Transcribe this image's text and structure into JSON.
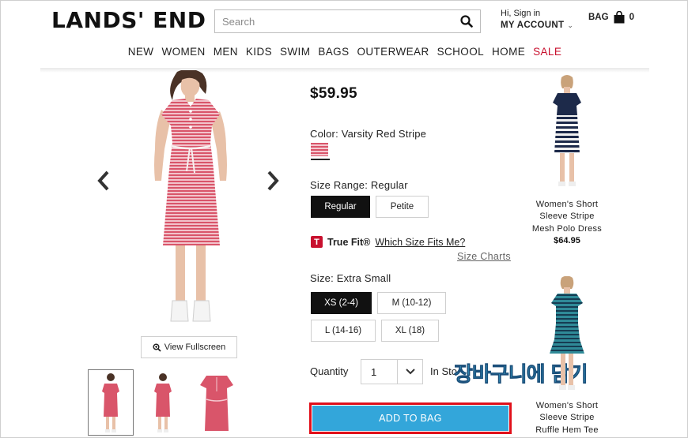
{
  "header": {
    "logo": "LANDS' END",
    "search_placeholder": "Search",
    "greeting": "Hi, Sign in",
    "account_label": "MY ACCOUNT",
    "bag_label": "BAG",
    "bag_count": "0"
  },
  "nav": [
    "NEW",
    "WOMEN",
    "MEN",
    "KIDS",
    "SWIM",
    "BAGS",
    "OUTERWEAR",
    "SCHOOL",
    "HOME",
    "SALE"
  ],
  "gallery": {
    "fullscreen_label": "View Fullscreen"
  },
  "product": {
    "price": "$59.95",
    "color_label": "Color: Varsity Red Stripe",
    "size_range_label": "Size Range: Regular",
    "size_ranges": [
      "Regular",
      "Petite"
    ],
    "truefit_brand": "True Fit®",
    "truefit_link": "Which Size Fits Me?",
    "size_charts": "Size Charts",
    "size_label": "Size: Extra Small",
    "sizes": [
      "XS (2-4)",
      "M (10-12)",
      "L (14-16)",
      "XL (18)"
    ],
    "quantity_label": "Quantity",
    "quantity_value": "1",
    "in_stock": "In Sto",
    "overlay_text": "장바구니에 담기",
    "add_to_bag": "ADD TO BAG"
  },
  "recommendations": [
    {
      "name": "Women's Short Sleeve Stripe Mesh Polo Dress",
      "price": "$64.95"
    },
    {
      "name": "Women's Short Sleeve Stripe Ruffle Hem Tee"
    }
  ],
  "colors": {
    "sale": "#c8102e",
    "add_button": "#33a6da",
    "highlight_border": "#e1101a",
    "overlay_text": "#40c2ea",
    "dress_stripe": "#d9556a"
  },
  "icons": [
    "search-icon",
    "chevron-down-icon",
    "shopping-bag-icon",
    "chevron-left-icon",
    "chevron-right-icon",
    "zoom-icon",
    "truefit-logo-icon"
  ]
}
